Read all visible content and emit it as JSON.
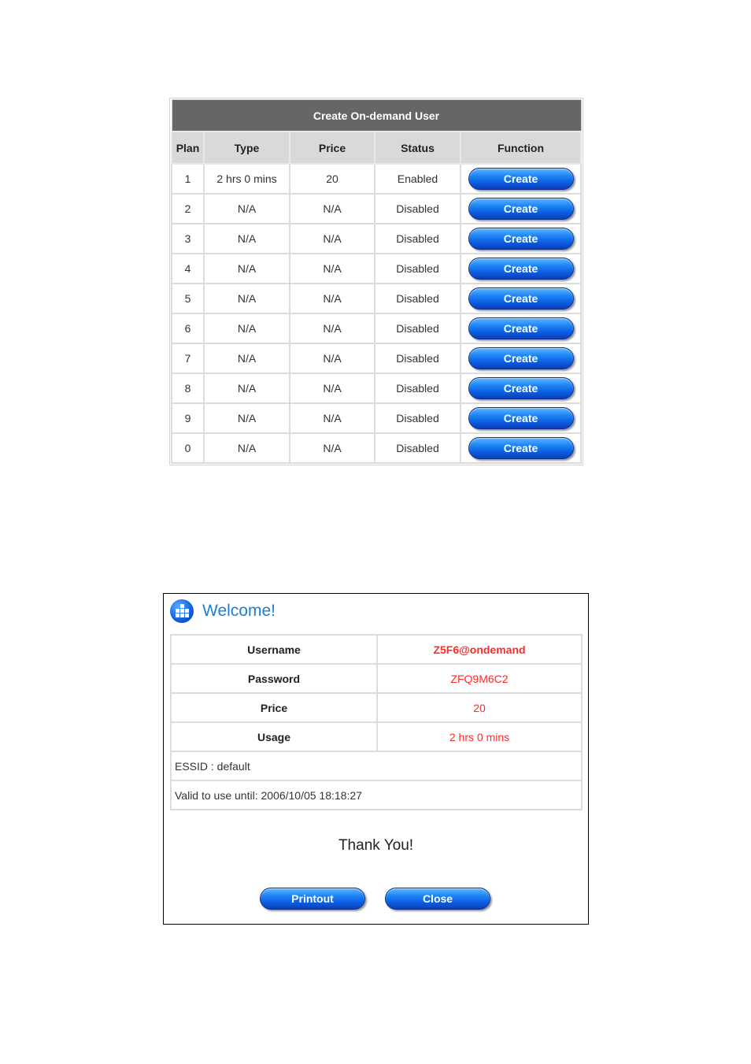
{
  "create_table": {
    "title": "Create On-demand User",
    "columns": [
      "Plan",
      "Type",
      "Price",
      "Status",
      "Function"
    ],
    "rows": [
      {
        "plan": "1",
        "type": "2 hrs 0 mins",
        "price": "20",
        "status": "Enabled",
        "action": "Create"
      },
      {
        "plan": "2",
        "type": "N/A",
        "price": "N/A",
        "status": "Disabled",
        "action": "Create"
      },
      {
        "plan": "3",
        "type": "N/A",
        "price": "N/A",
        "status": "Disabled",
        "action": "Create"
      },
      {
        "plan": "4",
        "type": "N/A",
        "price": "N/A",
        "status": "Disabled",
        "action": "Create"
      },
      {
        "plan": "5",
        "type": "N/A",
        "price": "N/A",
        "status": "Disabled",
        "action": "Create"
      },
      {
        "plan": "6",
        "type": "N/A",
        "price": "N/A",
        "status": "Disabled",
        "action": "Create"
      },
      {
        "plan": "7",
        "type": "N/A",
        "price": "N/A",
        "status": "Disabled",
        "action": "Create"
      },
      {
        "plan": "8",
        "type": "N/A",
        "price": "N/A",
        "status": "Disabled",
        "action": "Create"
      },
      {
        "plan": "9",
        "type": "N/A",
        "price": "N/A",
        "status": "Disabled",
        "action": "Create"
      },
      {
        "plan": "0",
        "type": "N/A",
        "price": "N/A",
        "status": "Disabled",
        "action": "Create"
      }
    ]
  },
  "welcome": {
    "icon": "grid-globe-icon",
    "title": "Welcome!",
    "fields": [
      {
        "label": "Username",
        "value": "Z5F6@ondemand"
      },
      {
        "label": "Password",
        "value": "ZFQ9M6C2"
      },
      {
        "label": "Price",
        "value": "20"
      },
      {
        "label": "Usage",
        "value": "2 hrs 0 mins"
      }
    ],
    "essid": "ESSID : default",
    "valid_until": "Valid to use until: 2006/10/05 18:18:27",
    "thanks": "Thank You!",
    "printout_label": "Printout",
    "close_label": "Close"
  },
  "colors": {
    "header_bg": "#666666",
    "column_header_bg": "#d9d9d9",
    "button_blue": "#1f86f5",
    "value_red": "#ff2a2a",
    "welcome_blue": "#1a7fd6"
  }
}
